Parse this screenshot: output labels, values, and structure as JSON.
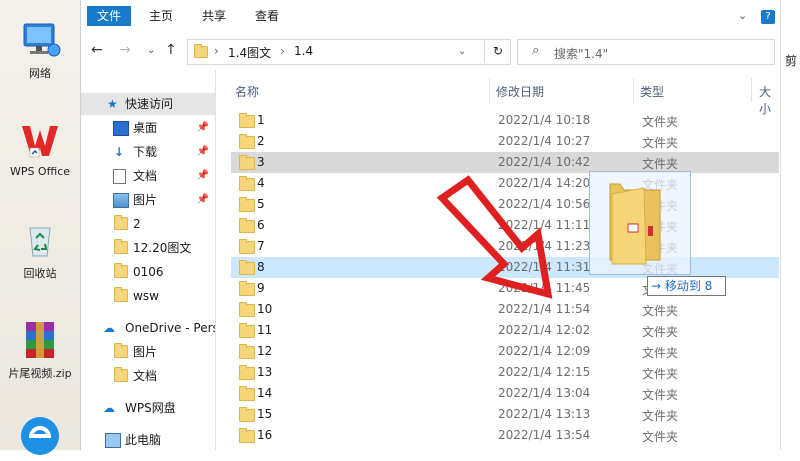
{
  "desktop": {
    "icons": [
      {
        "name": "network-icon",
        "label": "网络"
      },
      {
        "name": "wps-office-icon",
        "label": "WPS Office"
      },
      {
        "name": "recycle-bin-icon",
        "label": "回收站"
      },
      {
        "name": "winrar-icon",
        "label": "片尾视频.zip"
      },
      {
        "name": "browser-icon",
        "label": ""
      }
    ]
  },
  "ribbon": {
    "tabs": [
      "文件",
      "主页",
      "共享",
      "查看"
    ]
  },
  "address": {
    "segments": [
      "1.4图文",
      "1.4"
    ],
    "sep": "›"
  },
  "search": {
    "placeholder": "搜索\"1.4\""
  },
  "nav": {
    "quick_access": "快速访问",
    "pinned": [
      {
        "label": "桌面",
        "icon": "desktop-icon"
      },
      {
        "label": "下载",
        "icon": "download-icon"
      },
      {
        "label": "文档",
        "icon": "document-icon"
      },
      {
        "label": "图片",
        "icon": "picture-icon"
      }
    ],
    "folders": [
      "2",
      "12.20图文",
      "0106",
      "wsw"
    ],
    "onedrive": "OneDrive - Pers",
    "onedrive_items": [
      "图片",
      "文档"
    ],
    "wps_cloud": "WPS网盘",
    "this_pc": "此电脑"
  },
  "columns": {
    "name": "名称",
    "date": "修改日期",
    "type": "类型",
    "size": "大小"
  },
  "rows": [
    {
      "name": "1",
      "date": "2022/1/4 10:18",
      "type": "文件夹"
    },
    {
      "name": "2",
      "date": "2022/1/4 10:27",
      "type": "文件夹"
    },
    {
      "name": "3",
      "date": "2022/1/4 10:42",
      "type": "文件夹"
    },
    {
      "name": "4",
      "date": "2022/1/4 14:20",
      "type": "文件夹"
    },
    {
      "name": "5",
      "date": "2022/1/4 10:56",
      "type": "文件夹"
    },
    {
      "name": "6",
      "date": "2022/1/4 11:11",
      "type": "文件夹"
    },
    {
      "name": "7",
      "date": "2022/1/4 11:23",
      "type": "文件夹"
    },
    {
      "name": "8",
      "date": "2022/1/4 11:31",
      "type": "文件夹"
    },
    {
      "name": "9",
      "date": "2022/1/4 11:45",
      "type": "文件夹"
    },
    {
      "name": "10",
      "date": "2022/1/4 11:54",
      "type": "文件夹"
    },
    {
      "name": "11",
      "date": "2022/1/4 12:02",
      "type": "文件夹"
    },
    {
      "name": "12",
      "date": "2022/1/4 12:09",
      "type": "文件夹"
    },
    {
      "name": "13",
      "date": "2022/1/4 12:15",
      "type": "文件夹"
    },
    {
      "name": "14",
      "date": "2022/1/4 13:04",
      "type": "文件夹"
    },
    {
      "name": "15",
      "date": "2022/1/4 13:13",
      "type": "文件夹"
    },
    {
      "name": "16",
      "date": "2022/1/4 13:54",
      "type": "文件夹"
    }
  ],
  "drag": {
    "tooltip": "→ 移动到 8"
  },
  "right_edge": {
    "label": "剪"
  },
  "colors": {
    "accent": "#1979ca",
    "arrow": "#e02020",
    "folder": "#f7d67a"
  }
}
